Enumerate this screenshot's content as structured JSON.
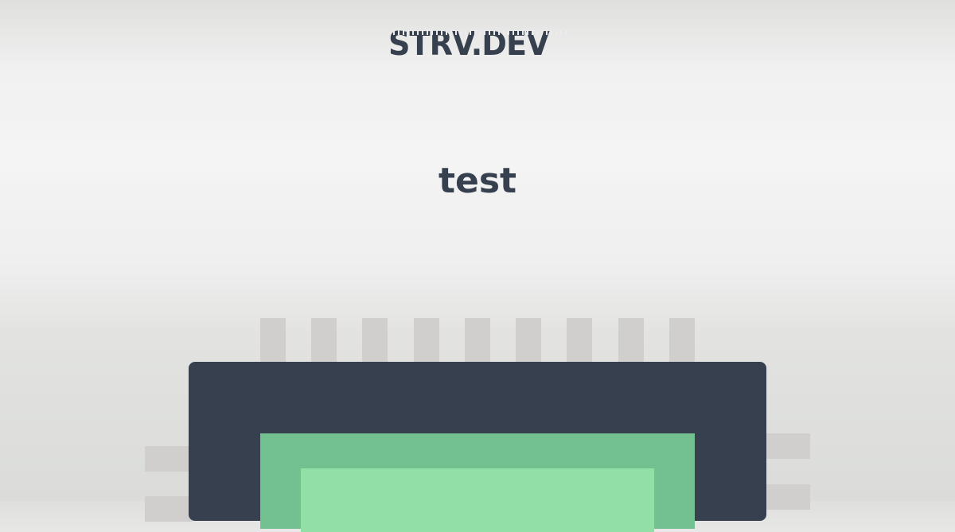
{
  "brand": {
    "logo_text": "STRV.DEV",
    "text_color": "#36404e"
  },
  "title": "test",
  "illustration": {
    "icon": "microchip-icon",
    "colors": {
      "body": "#36404e",
      "core_outer": "#73c190",
      "core_inner": "#92e0a8",
      "pins": "#d0cfcd"
    }
  }
}
